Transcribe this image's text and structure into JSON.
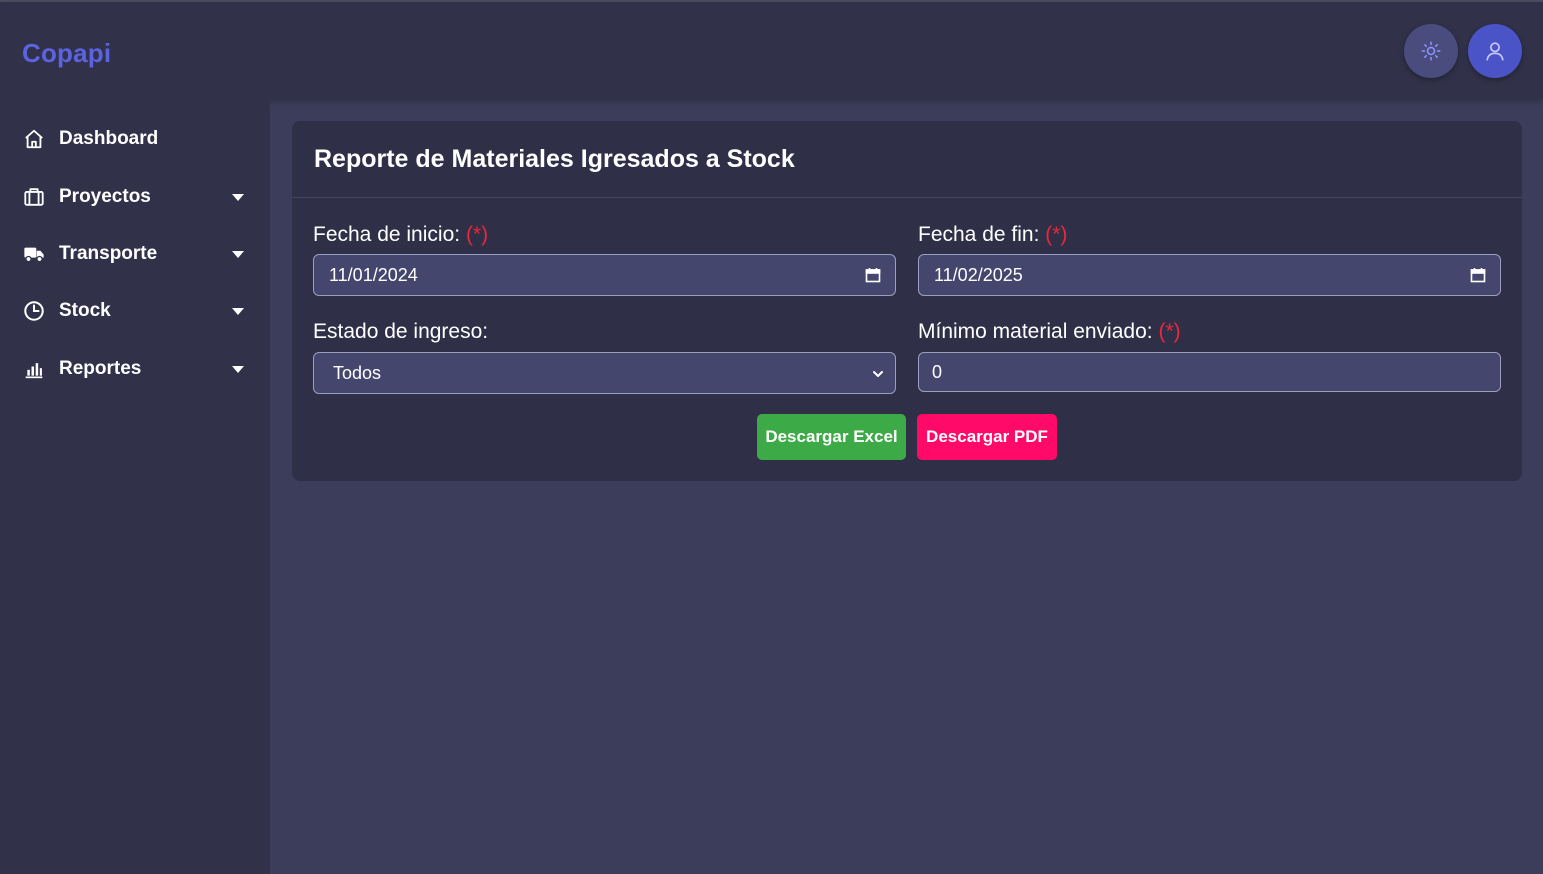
{
  "app": {
    "brand": "Copapi"
  },
  "header": {
    "theme_toggle_icon": "sun-icon",
    "user_icon": "user-icon"
  },
  "sidebar": {
    "items": [
      {
        "label": "Dashboard",
        "icon": "home-icon",
        "has_dropdown": false
      },
      {
        "label": "Proyectos",
        "icon": "briefcase-icon",
        "has_dropdown": true
      },
      {
        "label": "Transporte",
        "icon": "truck-icon",
        "has_dropdown": true
      },
      {
        "label": "Stock",
        "icon": "clock-icon",
        "has_dropdown": true
      },
      {
        "label": "Reportes",
        "icon": "bar-chart-icon",
        "has_dropdown": true
      }
    ]
  },
  "report": {
    "title": "Reporte de Materiales Igresados a Stock",
    "required_marker": "(*)",
    "start_date": {
      "label": "Fecha de inicio:",
      "value": "11/01/2024"
    },
    "end_date": {
      "label": "Fecha de fin:",
      "value": "11/02/2025"
    },
    "status": {
      "label": "Estado de ingreso:",
      "value": "Todos"
    },
    "min_material": {
      "label": "Mínimo material enviado:",
      "value": "0"
    },
    "buttons": {
      "excel": "Descargar Excel",
      "pdf": "Descargar PDF"
    }
  },
  "colors": {
    "brand": "#5b63e0",
    "excel_button": "#3cab47",
    "pdf_button": "#ff0a69",
    "required": "#e8283c",
    "background": "#3c3d5a",
    "panel": "#31324a"
  }
}
